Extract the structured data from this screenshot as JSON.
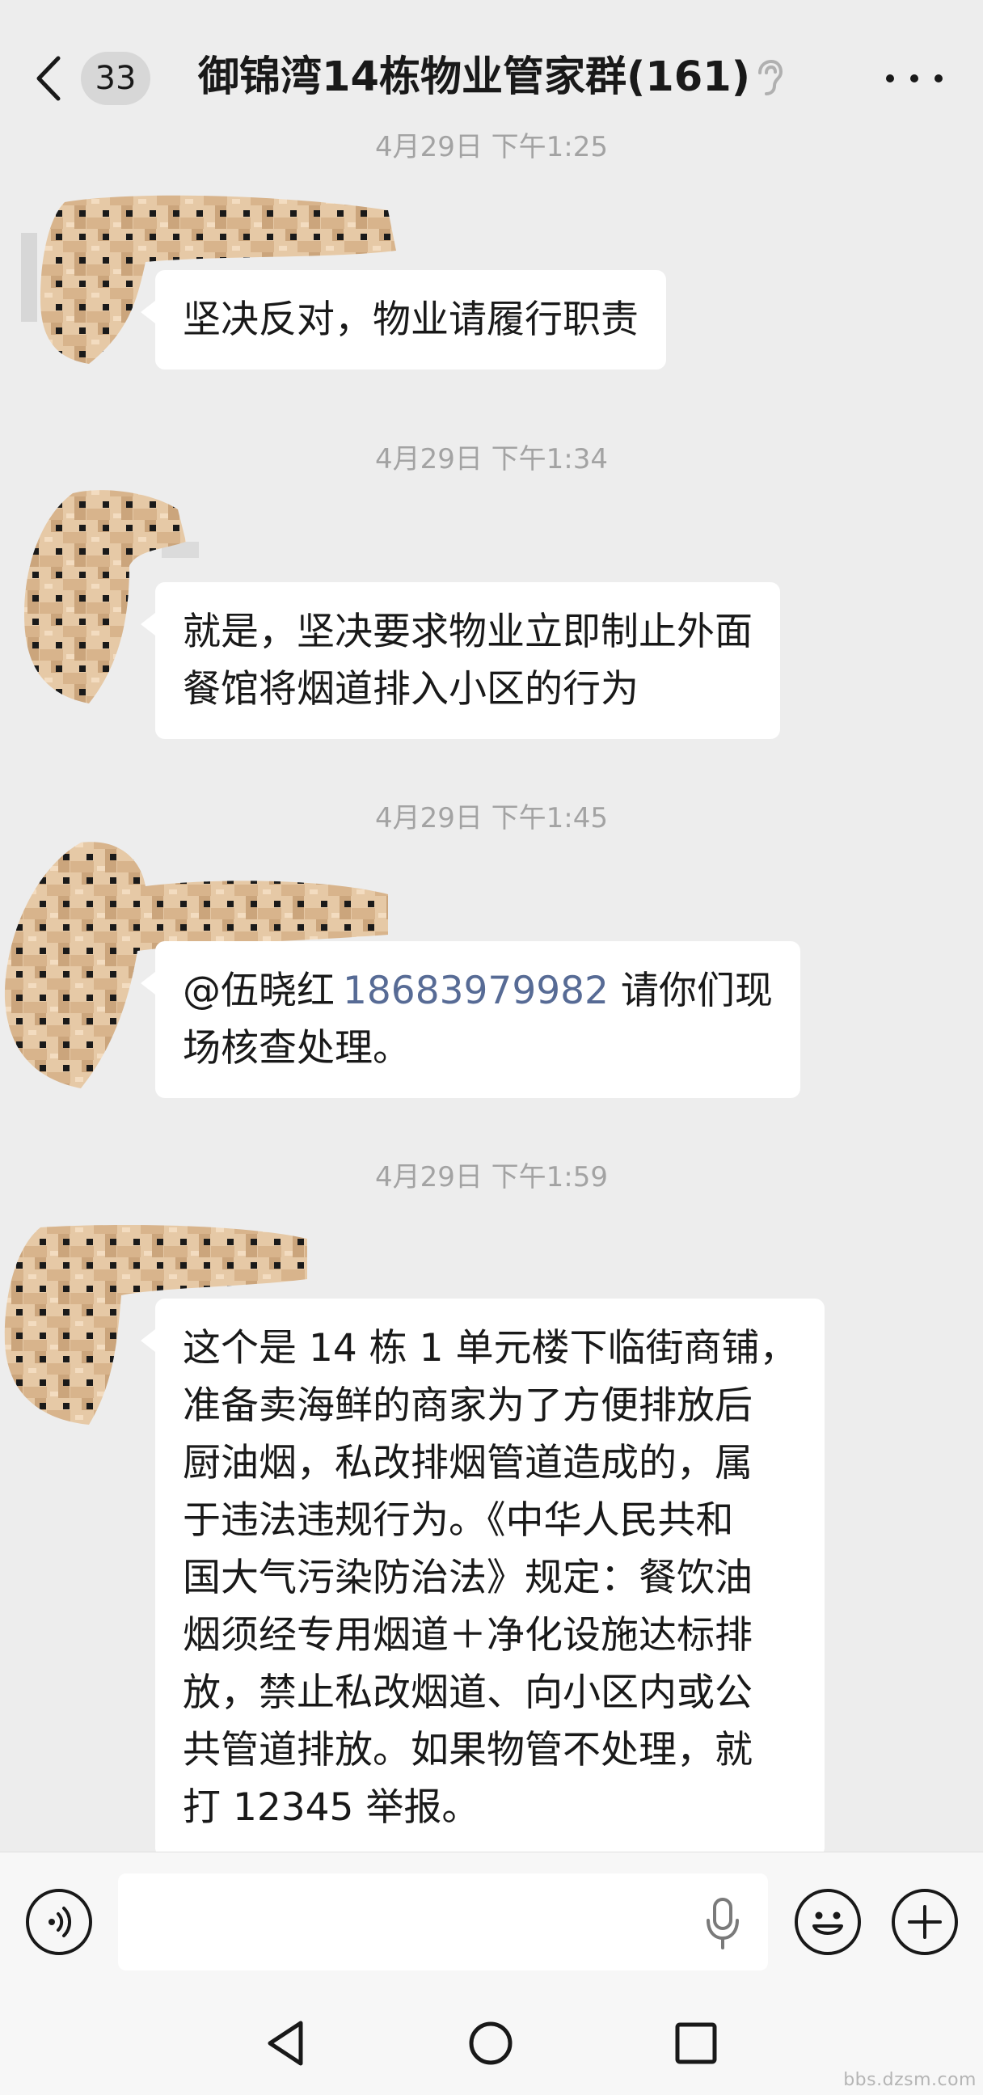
{
  "header": {
    "unread_count": "33",
    "title": "御锦湾14栋物业管家群(161)"
  },
  "messages": [
    {
      "timestamp": "4月29日 下午1:25",
      "text": "坚决反对，物业请履行职责"
    },
    {
      "timestamp": "4月29日 下午1:34",
      "lines": [
        "就是，坚决要求物业立即制止外面",
        "餐馆将烟道排入小区的行为"
      ]
    },
    {
      "timestamp": "4月29日 下午1:45",
      "mention": "@伍晓红",
      "phone": "18683979982",
      "tail": " 请你们现",
      "line2": "场核查处理。"
    },
    {
      "timestamp": "4月29日 下午1:59",
      "lines": [
        "这个是 14 栋 1 单元楼下临街商铺，",
        "准备卖海鲜的商家为了方便排放后",
        "厨油烟，私改排烟管道造成的，属",
        "于违法违规行为。《中华人民共和",
        "国大气污染防治法》规定：餐饮油",
        "烟须经专用烟道＋净化设施达标排",
        "放，禁止私改烟道、向小区内或公",
        "共管道排放。如果物管不处理，就",
        "打 12345 举报。"
      ]
    }
  ],
  "input": {
    "placeholder": ""
  },
  "watermark": "bbs.dzsm.com"
}
